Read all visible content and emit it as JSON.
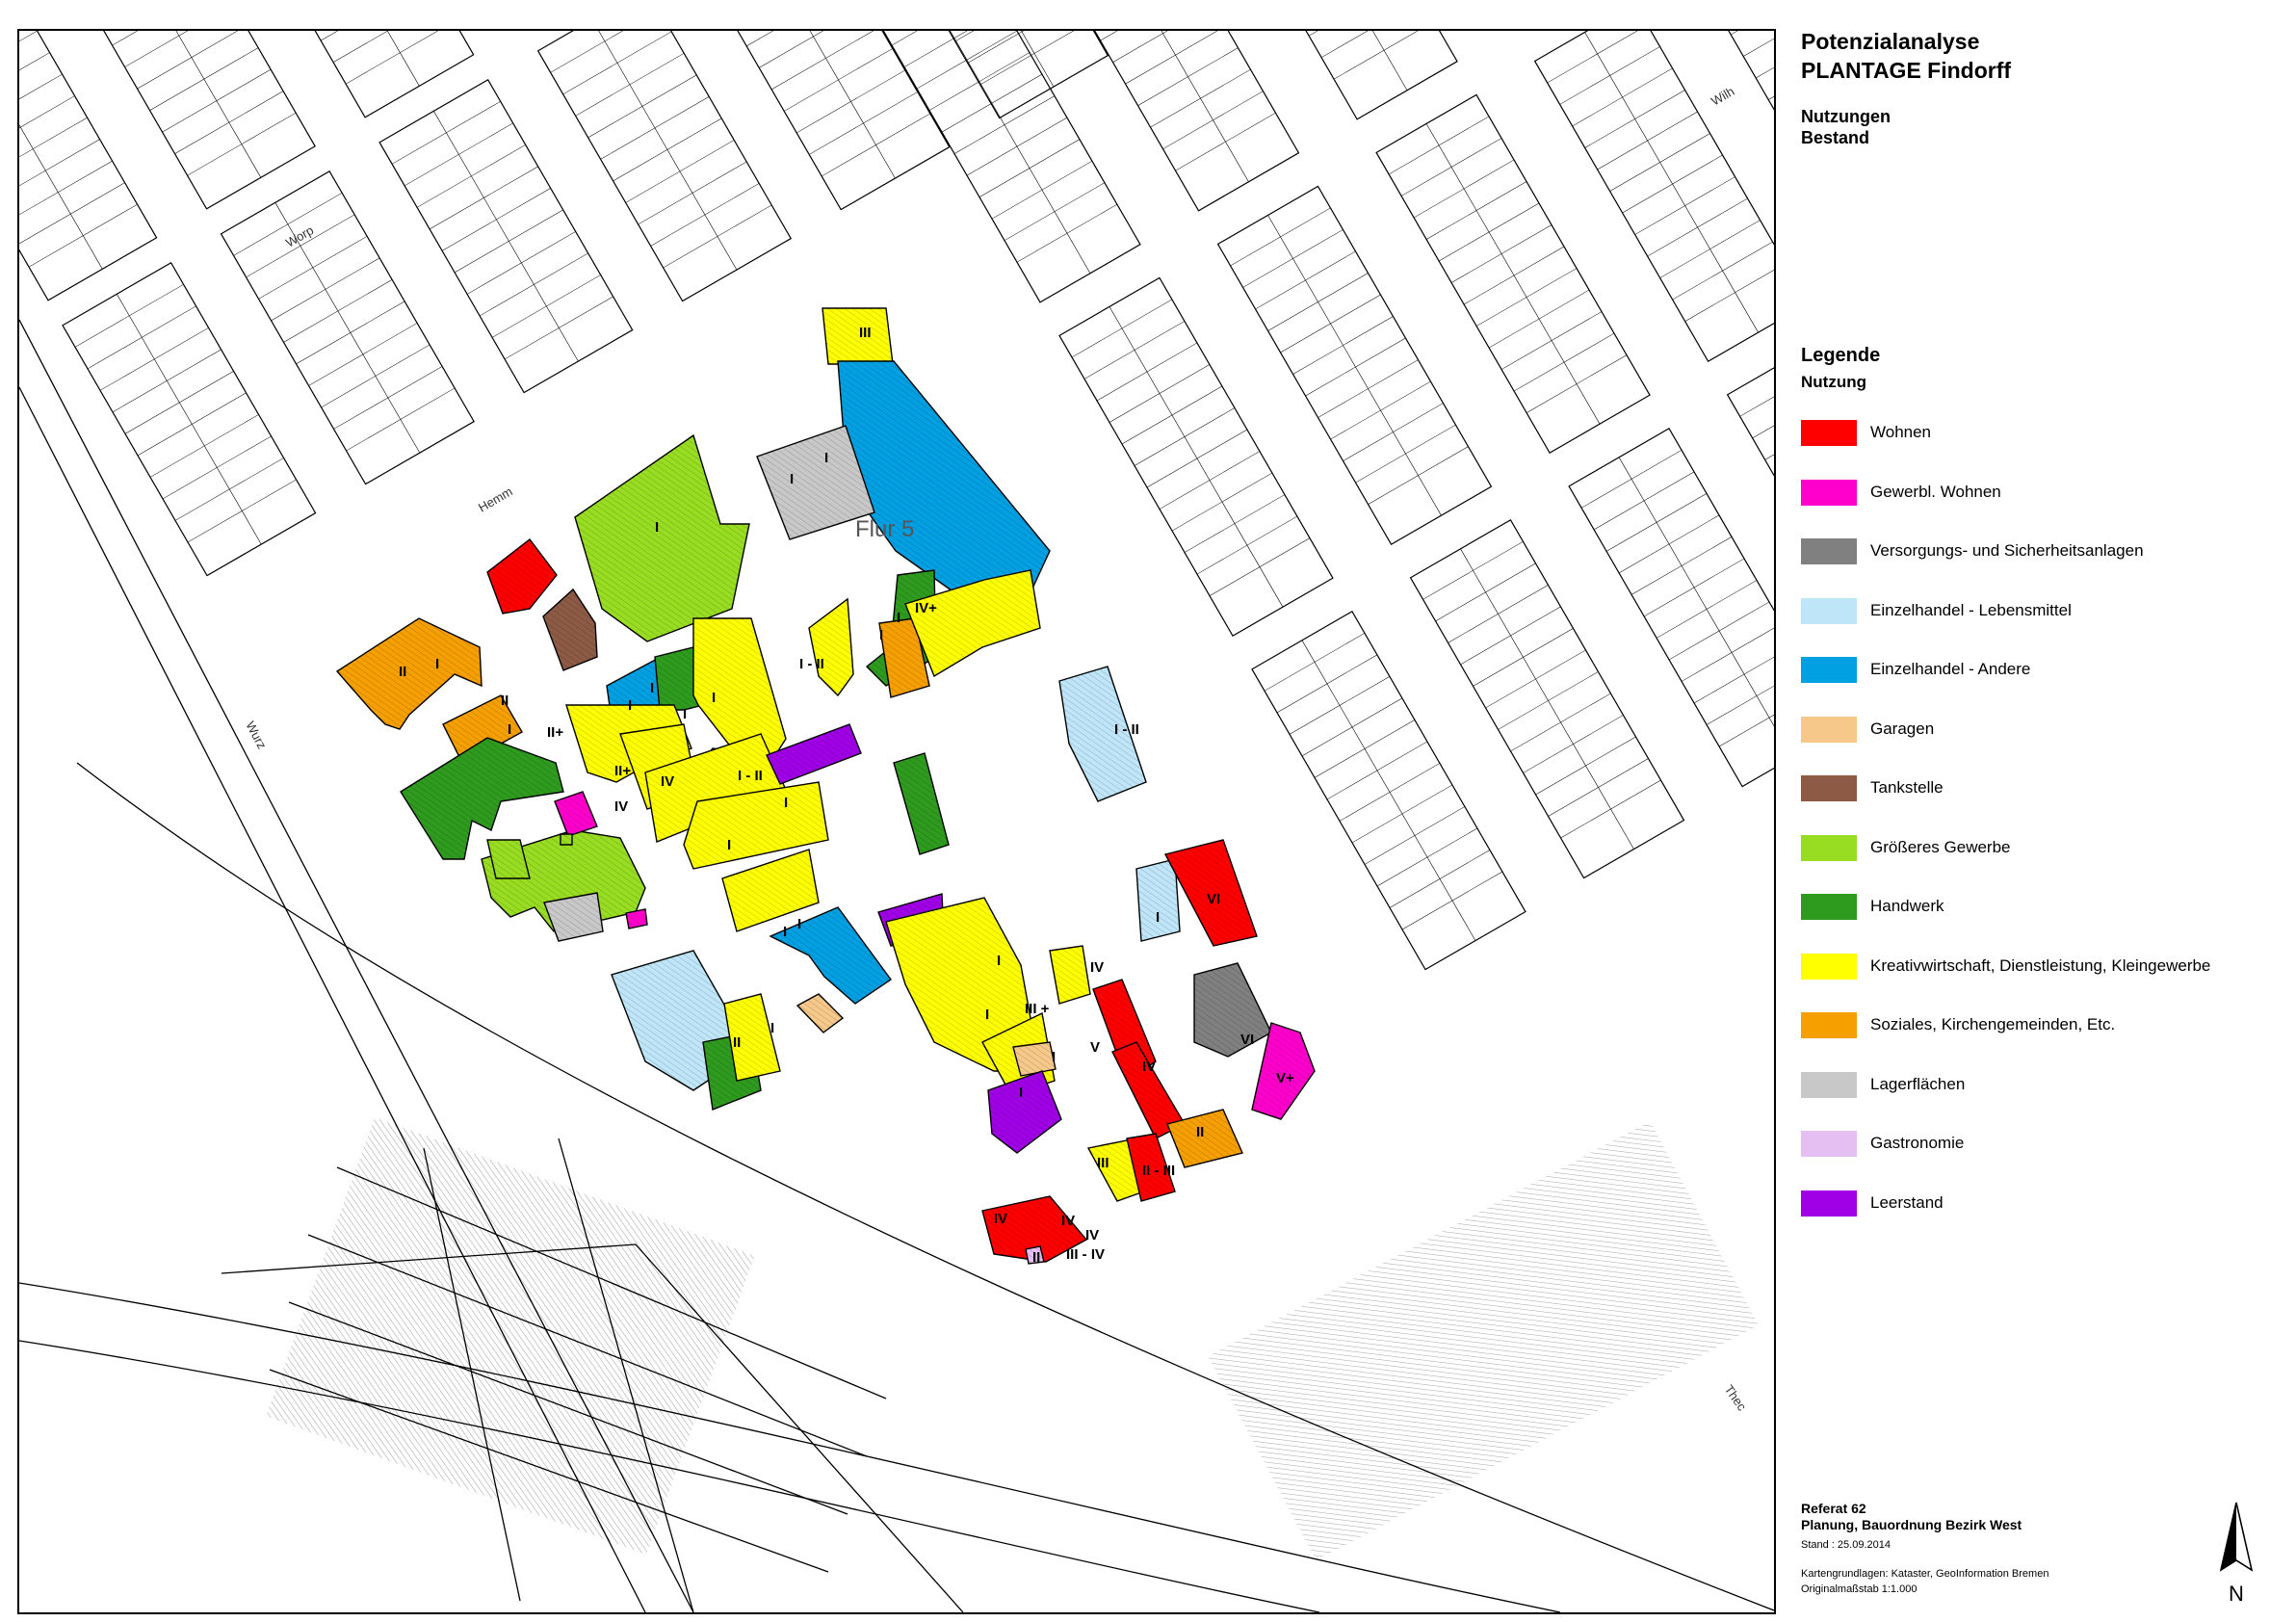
{
  "header": {
    "title_line1": "Potenzialanalyse",
    "title_line2": "PLANTAGE Findorff",
    "sub_line1": "Nutzungen",
    "sub_line2": "Bestand"
  },
  "legend": {
    "heading": "Legende",
    "subheading": "Nutzung",
    "items": [
      {
        "label": "Wohnen",
        "color": "#ff0000"
      },
      {
        "label": "Gewerbl. Wohnen",
        "color": "#ff00cc"
      },
      {
        "label": "Versorgungs- und Sicherheitsanlagen",
        "color": "#808080"
      },
      {
        "label": "Einzelhandel - Lebensmittel",
        "color": "#bfe6f8"
      },
      {
        "label": "Einzelhandel - Andere",
        "color": "#00a0e3"
      },
      {
        "label": "Garagen",
        "color": "#f6c98a"
      },
      {
        "label": "Tankstelle",
        "color": "#8c5a45"
      },
      {
        "label": "Größeres Gewerbe",
        "color": "#99dd22"
      },
      {
        "label": "Handwerk",
        "color": "#2e9b1e"
      },
      {
        "label": "Kreativwirtschaft, Dienstleistung, Kleingewerbe",
        "color": "#ffff00"
      },
      {
        "label": "Soziales, Kirchengemeinden, Etc.",
        "color": "#f5a000"
      },
      {
        "label": "Lagerflächen",
        "color": "#c8c8c8"
      },
      {
        "label": "Gastronomie",
        "color": "#e6bff2"
      },
      {
        "label": "Leerstand",
        "color": "#a000e6"
      }
    ]
  },
  "map": {
    "flur_label": "Flur 5",
    "street_labels": [
      "Worp",
      "Hemm",
      "Wurz",
      "Wilh",
      "Thec"
    ],
    "floor_labels": [
      "III",
      "I",
      "I",
      "I",
      "IV+",
      "I - II",
      "I",
      "I",
      "II",
      "II",
      "I",
      "II+",
      "I",
      "II+",
      "I",
      "IV",
      "IV",
      "I",
      "I",
      "I - II",
      "I",
      "I",
      "I",
      "I",
      "I",
      "I - II",
      "III +",
      "I",
      "I",
      "I",
      "I",
      "VI",
      "I",
      "IV",
      "V",
      "IV",
      "VI",
      "V+",
      "II",
      "III",
      "II - III",
      "IV",
      "IV",
      "III - IV",
      "IV",
      "II",
      "I",
      "II"
    ]
  },
  "footer": {
    "org": "Referat 62",
    "dept": "Planung, Bauordnung Bezirk West",
    "date": "Stand : 25.09.2014",
    "source": "Kartengrundlagen: Kataster, GeoInformation Bremen",
    "scale": "Originalmaßstab 1:1.000",
    "north": "N"
  }
}
